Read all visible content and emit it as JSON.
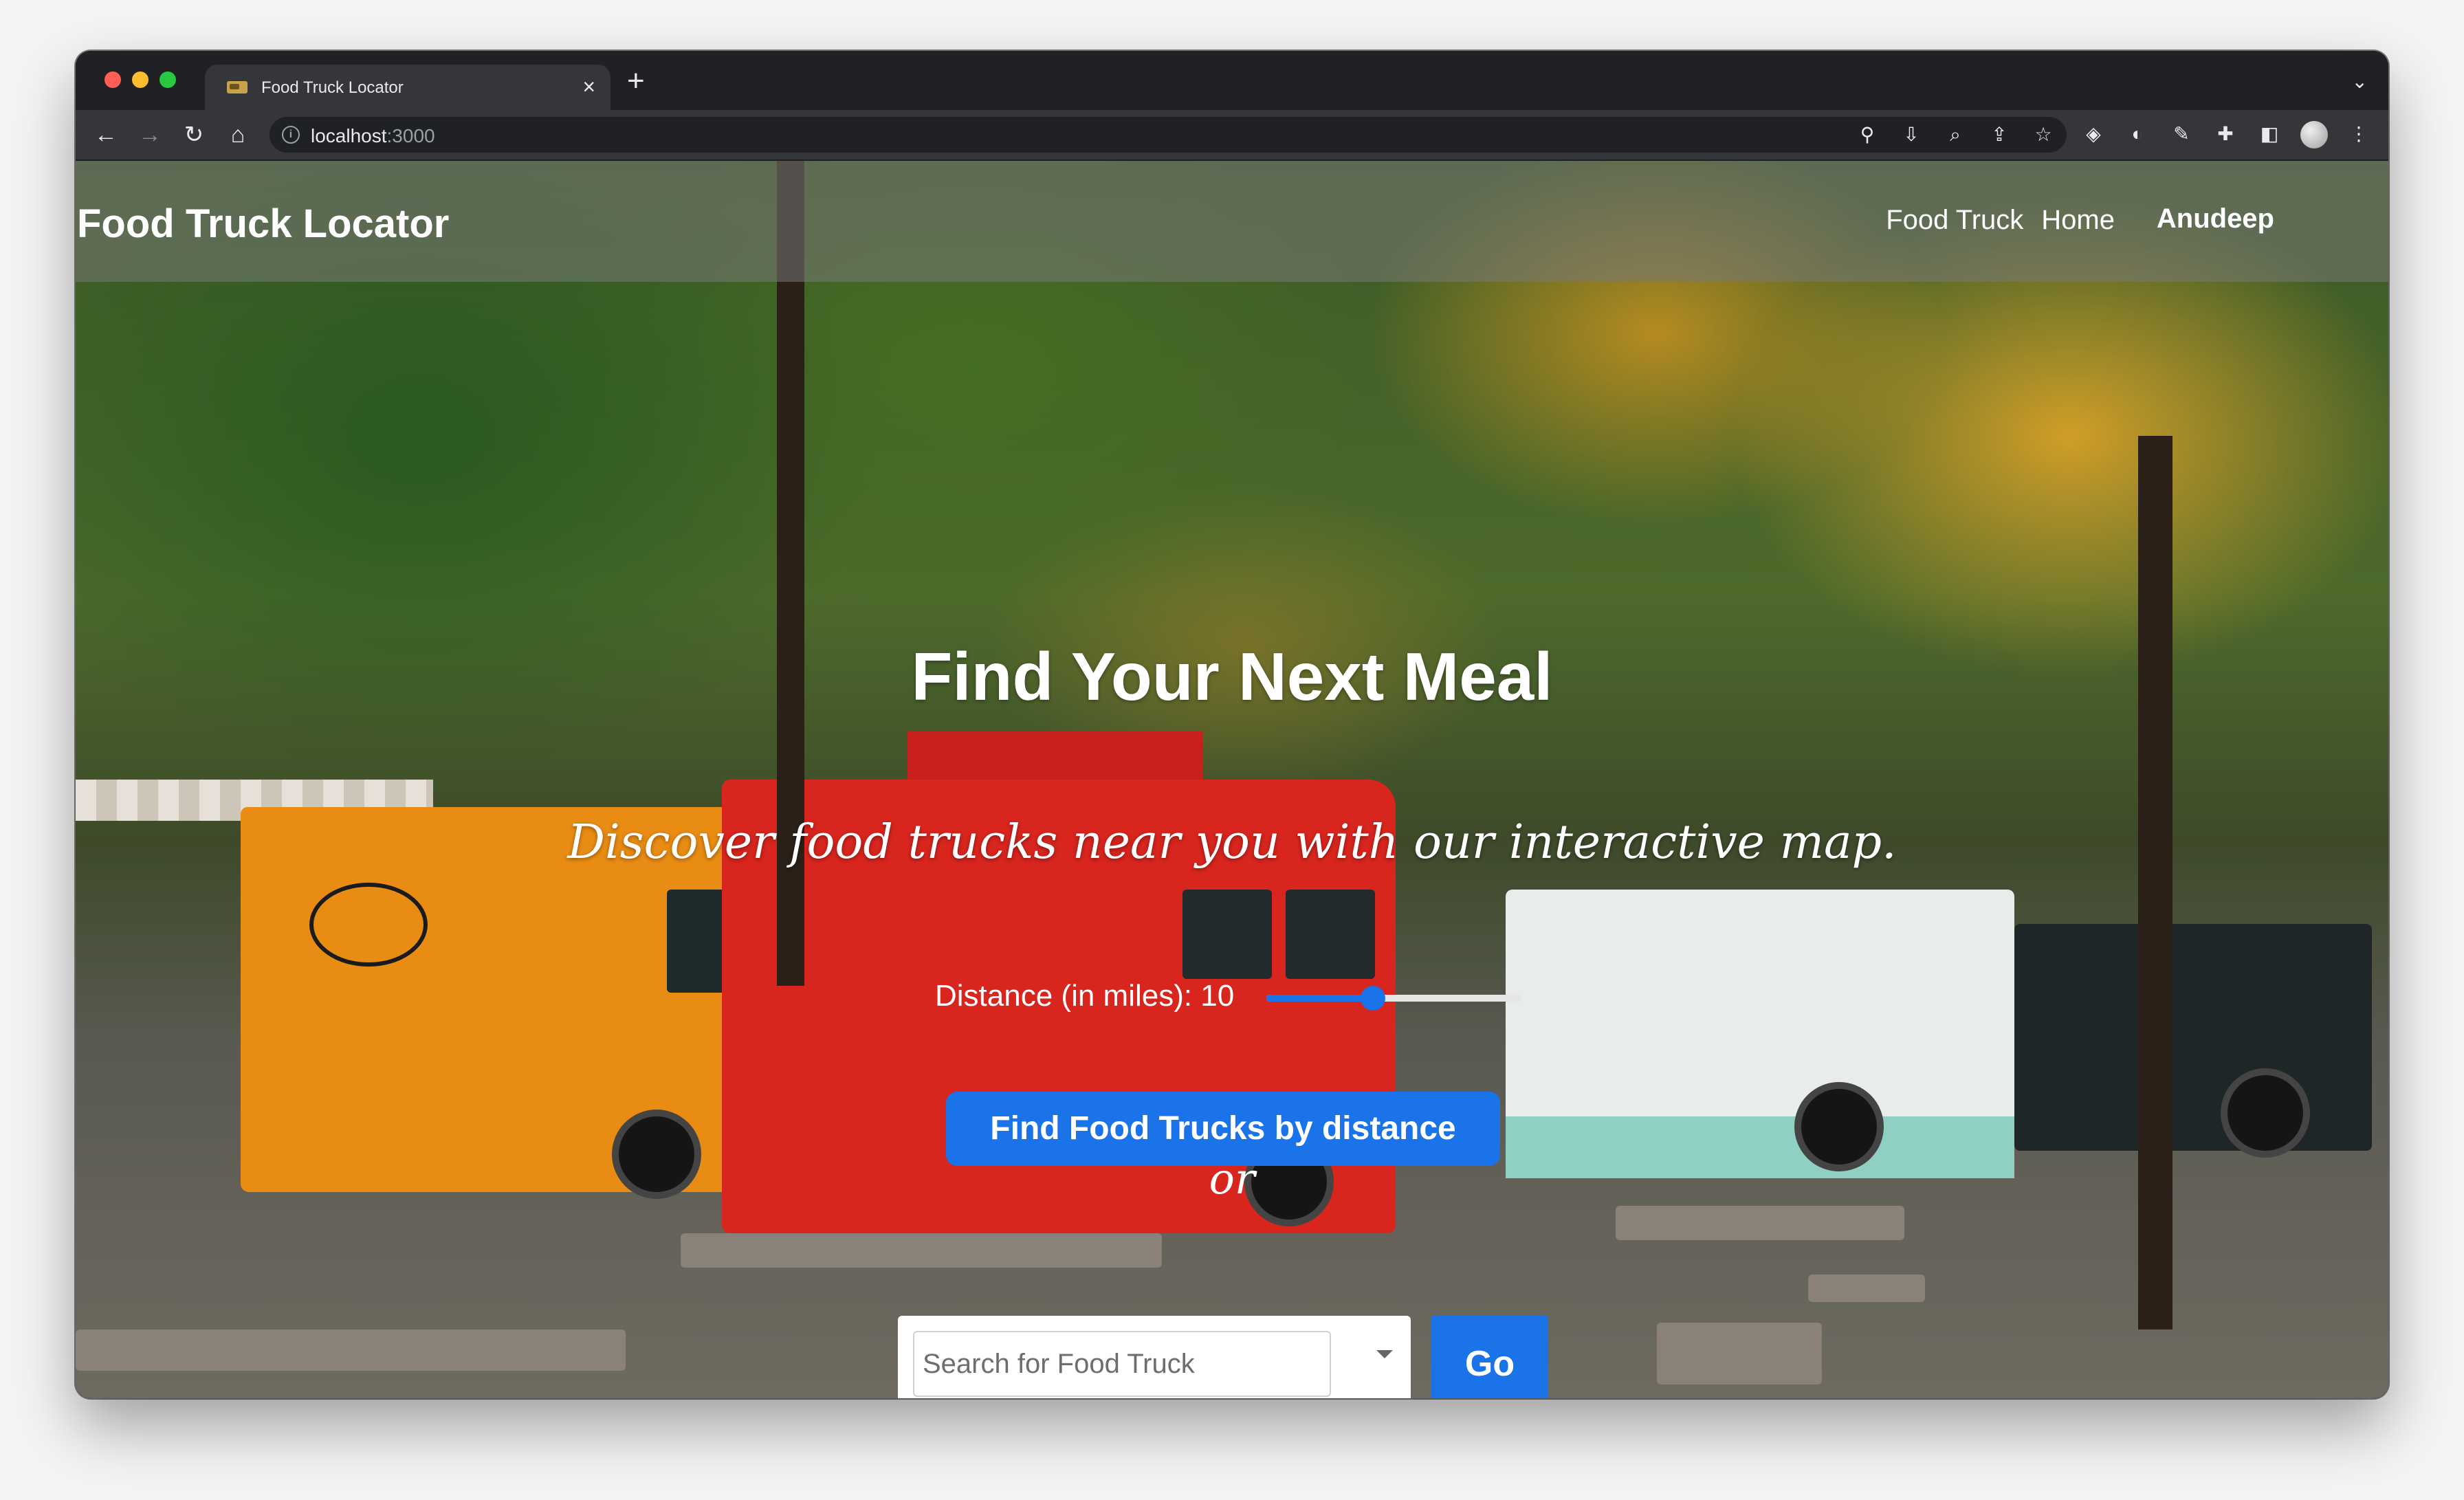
{
  "browser": {
    "tab_title": "Food Truck Locator",
    "tab_close": "×",
    "new_tab": "+",
    "url_host": "localhost",
    "url_port": ":3000"
  },
  "navbar": {
    "brand": "Food Truck Locator",
    "links": [
      "Food Truck",
      "Home"
    ],
    "user": "Anudeep"
  },
  "hero": {
    "title": "Find Your Next Meal",
    "subtitle": "Discover food trucks near you with our interactive map."
  },
  "distance": {
    "label": "Distance (in miles): 10",
    "value": 10,
    "slider_fraction": 0.42
  },
  "find_button": "Find Food Trucks by distance",
  "or_text": "or",
  "search": {
    "placeholder": "Search for Food Truck",
    "go_label": "Go"
  },
  "colors": {
    "accent": "#1a73e8"
  }
}
